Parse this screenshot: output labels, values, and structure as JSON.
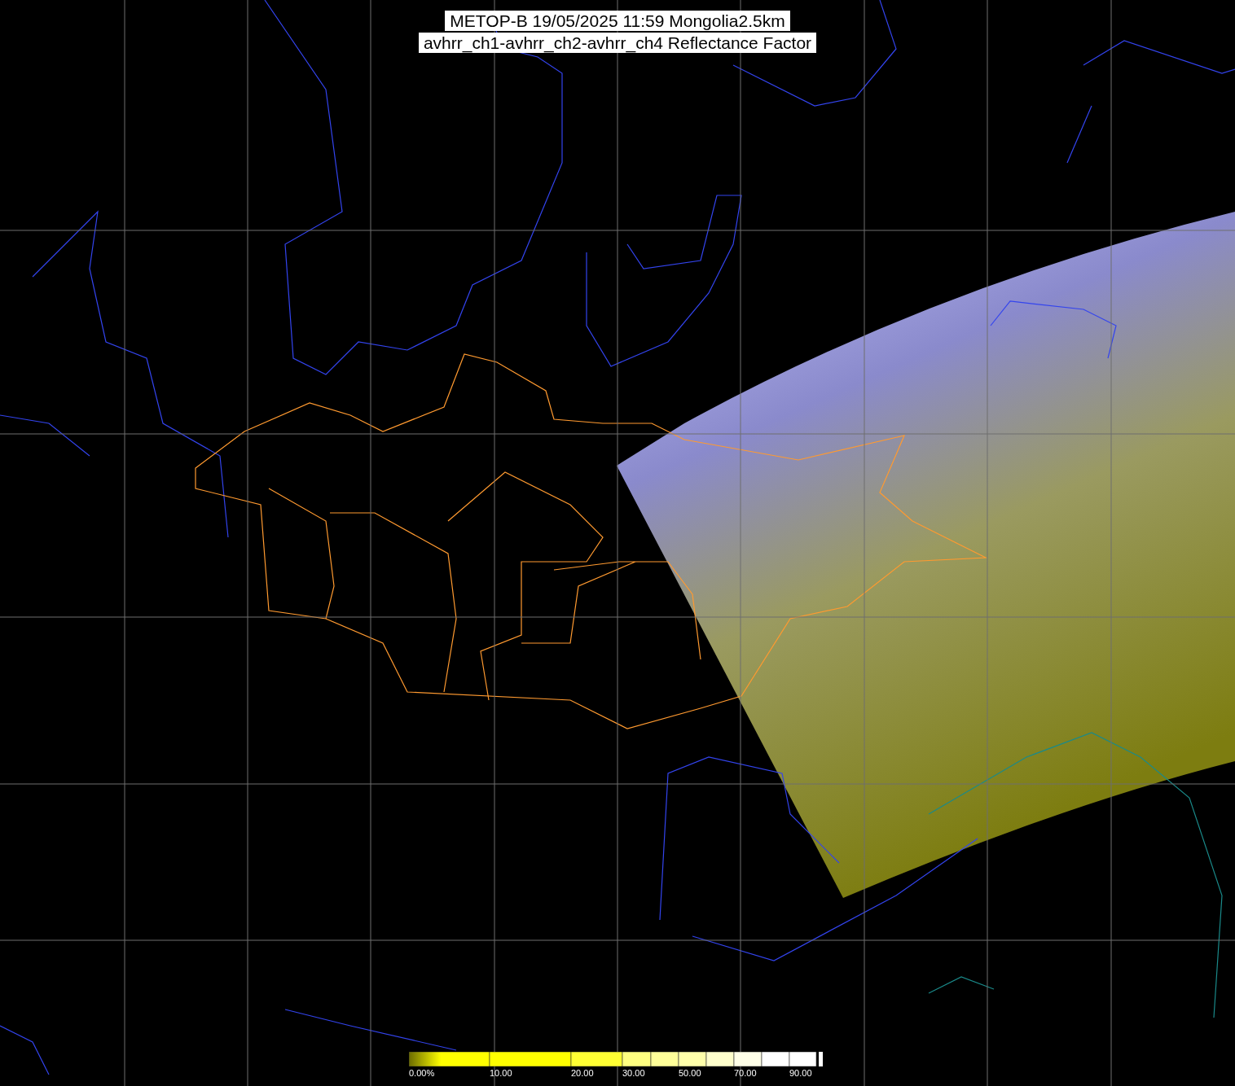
{
  "title": [
    "METOP-B 19/05/2025 11:59 Mongolia2.5km",
    "avhrr_ch1-avhrr_ch2-avhrr_ch4 Reflectance Factor"
  ],
  "colorbar": {
    "labels": [
      "0.00%",
      "10.00",
      "20.00",
      "30.00",
      "50.00",
      "70.00",
      "90.00"
    ]
  }
}
